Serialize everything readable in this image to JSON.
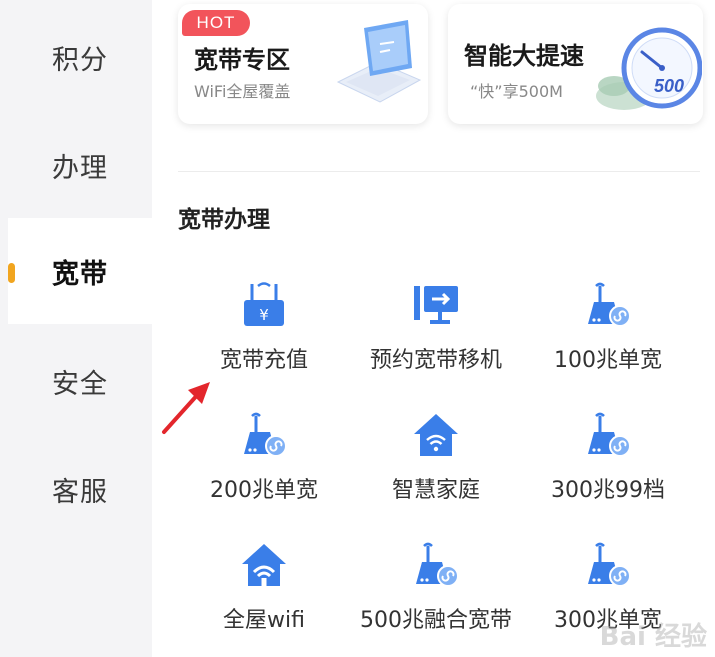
{
  "sidebar": {
    "items": [
      {
        "label": "积分"
      },
      {
        "label": "办理"
      },
      {
        "label": "宽带"
      },
      {
        "label": "安全"
      },
      {
        "label": "客服"
      }
    ]
  },
  "cards": {
    "broadband_zone": {
      "badge": "HOT",
      "title": "宽带专区",
      "subtitle": "WiFi全屋覆盖"
    },
    "speed_up": {
      "title": "智能大提速",
      "subtitle": "“快”享500M",
      "gauge_value": "500"
    }
  },
  "section": {
    "title": "宽带办理"
  },
  "services": [
    {
      "label": "宽带充值",
      "icon": "router-yuan-icon"
    },
    {
      "label": "预约宽带移机",
      "icon": "monitor-transfer-icon"
    },
    {
      "label": "100兆单宽",
      "icon": "router-link-icon"
    },
    {
      "label": "200兆单宽",
      "icon": "router-link-icon"
    },
    {
      "label": "智慧家庭",
      "icon": "smart-home-wifi-icon"
    },
    {
      "label": "300兆99档",
      "icon": "router-link-icon"
    },
    {
      "label": "全屋wifi",
      "icon": "home-wifi-icon"
    },
    {
      "label": "500兆融合宽带",
      "icon": "router-link-icon"
    },
    {
      "label": "300兆单宽",
      "icon": "router-link-icon"
    }
  ],
  "watermark": {
    "text": "Bai 经验"
  },
  "colors": {
    "accent_blue": "#3a7ee8",
    "indicator": "#f1a51f",
    "hot": "#f2545b",
    "arrow": "#e3262c"
  }
}
